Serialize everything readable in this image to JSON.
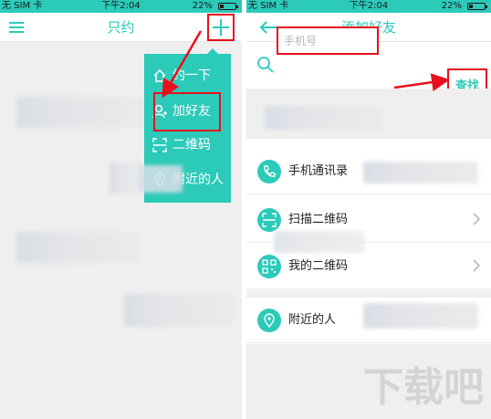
{
  "colors": {
    "accent": "#2ccab9",
    "highlight": "#e8101c",
    "background": "#efefef"
  },
  "left": {
    "status": {
      "carrier": "无 SIM 卡",
      "time": "下午2:04",
      "battery": "22%"
    },
    "title": "只约",
    "menu_icon": "menu-icon",
    "add_icon": "plus-icon",
    "dropdown": [
      {
        "icon": "home-icon",
        "label": "约一下"
      },
      {
        "icon": "add-person-icon",
        "label": "加好友"
      },
      {
        "icon": "scan-icon",
        "label": "二维码"
      },
      {
        "icon": "location-icon",
        "label": "附近的人"
      }
    ]
  },
  "right": {
    "status": {
      "carrier": "无 SIM 卡",
      "time": "下午2:04",
      "battery": "22%"
    },
    "title": "添加好友",
    "back_icon": "back-arrow-icon",
    "search": {
      "placeholder": "手机号",
      "value": ""
    },
    "find_label": "查找",
    "items": [
      {
        "icon": "phone-icon",
        "label": "手机通讯录",
        "chevron": false
      },
      {
        "icon": "scan-icon",
        "label": "扫描二维码",
        "chevron": true
      },
      {
        "icon": "qrcode-icon",
        "label": "我的二维码",
        "chevron": true
      },
      {
        "icon": "location-icon",
        "label": "附近的人",
        "chevron": false
      }
    ]
  },
  "watermark": "下载吧"
}
